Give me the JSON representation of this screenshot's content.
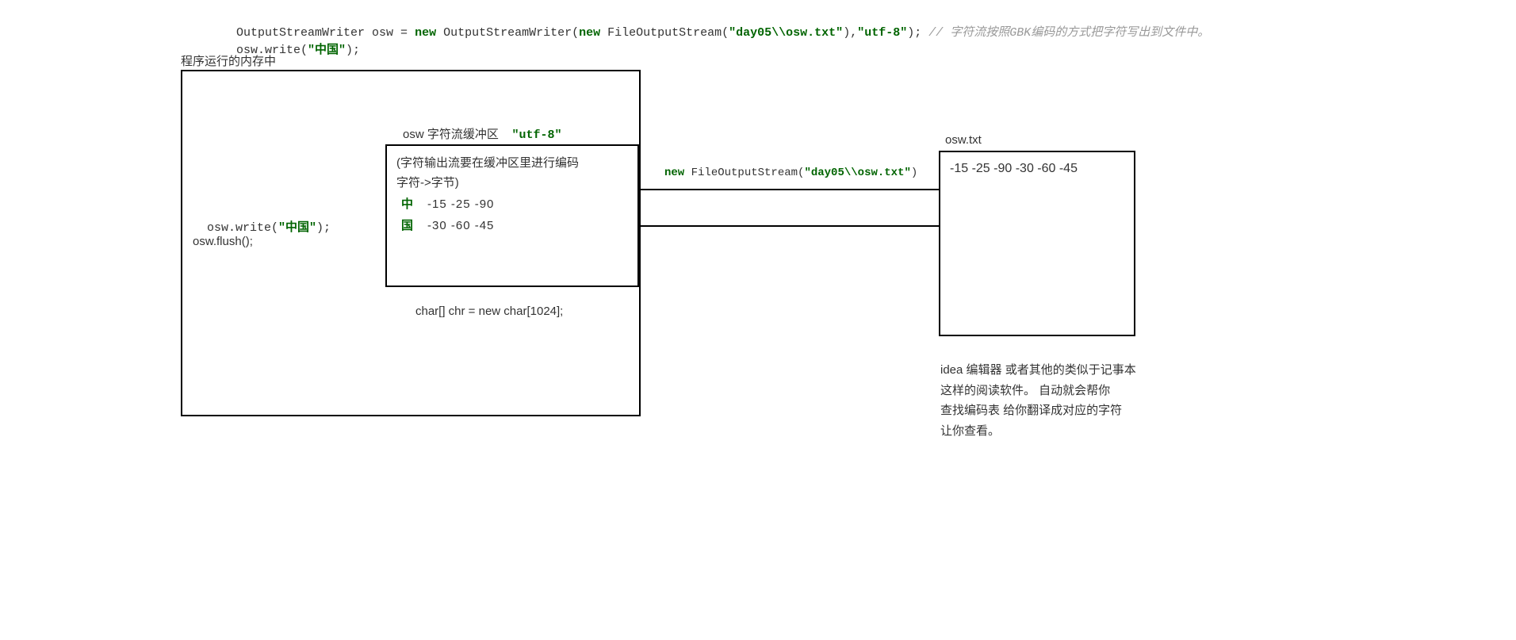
{
  "code": {
    "line1_pre": "OutputStreamWriter osw = ",
    "line1_new1": "new",
    "line1_mid1": " OutputStreamWriter(",
    "line1_new2": "new",
    "line1_mid2": " FileOutputStream(",
    "line1_path": "\"day05\\\\osw.txt\"",
    "line1_mid3": "),",
    "line1_enc": "\"utf-8\"",
    "line1_end": "); ",
    "line1_comment": "// 字符流按照GBK编码的方式把字符写出到文件中。",
    "line2_pre": "osw.write(",
    "line2_str": "\"中国\"",
    "line2_end": ");"
  },
  "memory_label": "程序运行的内存中",
  "left_calls": {
    "write_pre": "osw.write(",
    "write_str": "\"中国\"",
    "write_end": ");",
    "flush": "osw.flush();"
  },
  "buffer": {
    "title_pre": "osw 字符流缓冲区",
    "title_enc": "\"utf-8\"",
    "note1": "(字符输出流要在缓冲区里进行编码",
    "note2": "字符->字节)",
    "rows": [
      {
        "ch": "中",
        "bytes": "-15 -25  -90"
      },
      {
        "ch": "国",
        "bytes": "-30 -60 -45"
      }
    ]
  },
  "char_decl": "char[] chr = new char[1024];",
  "stream_label_pre": "new",
  "stream_label_mid": " FileOutputStream(",
  "stream_label_path": "\"day05\\\\osw.txt\"",
  "stream_label_end": ")",
  "file": {
    "name": "osw.txt",
    "bytes": "-15 -25  -90   -30   -60 -45"
  },
  "desc": {
    "l1": "idea 编辑器 或者其他的类似于记事本",
    "l2": "这样的阅读软件。 自动就会帮你",
    "l3": "查找编码表 给你翻译成对应的字符",
    "l4": "让你查看。"
  }
}
